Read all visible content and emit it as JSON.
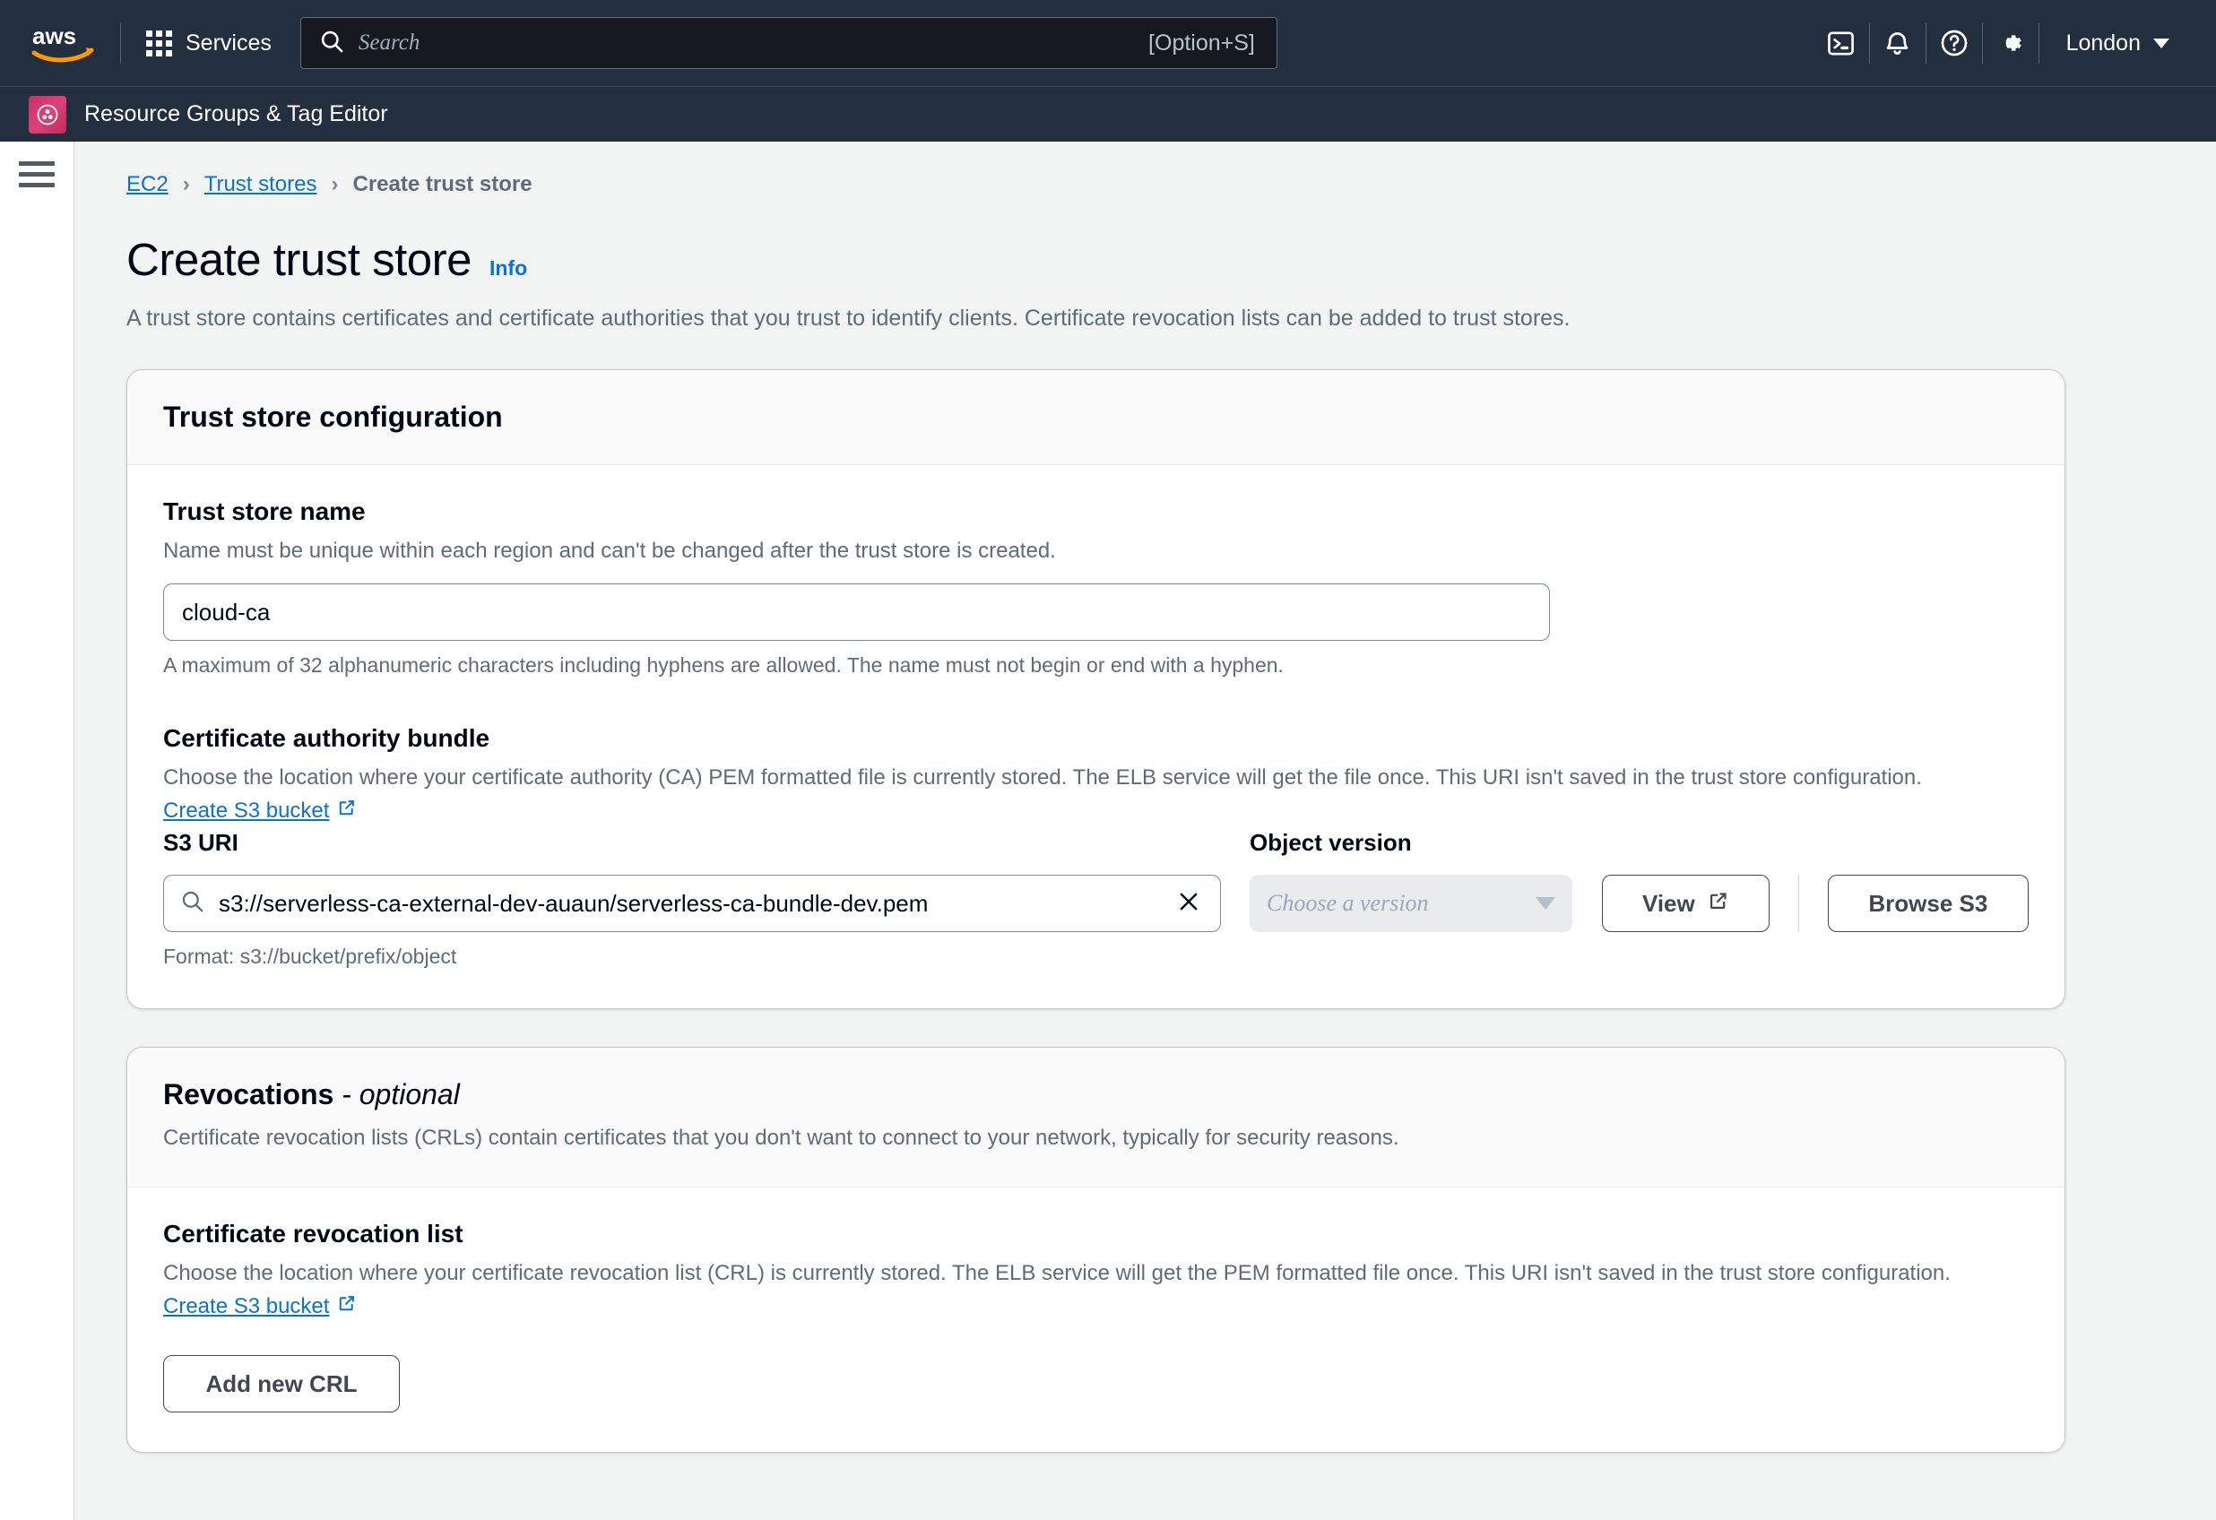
{
  "topnav": {
    "logo_alt": "aws",
    "services_label": "Services",
    "search_placeholder": "Search",
    "search_shortcut": "[Option+S]",
    "icons": [
      "cloudshell-icon",
      "bell-icon",
      "help-icon",
      "settings-icon"
    ],
    "region_label": "London"
  },
  "servicebar": {
    "title": "Resource Groups & Tag Editor"
  },
  "breadcrumb": {
    "items": [
      {
        "label": "EC2",
        "type": "link"
      },
      {
        "label": "Trust stores",
        "type": "link"
      },
      {
        "label": "Create trust store",
        "type": "current"
      }
    ],
    "separator": "›"
  },
  "header": {
    "title": "Create trust store",
    "info_label": "Info",
    "description": "A trust store contains certificates and certificate authorities that you trust to identify clients. Certificate revocation lists can be added to trust stores."
  },
  "config_card": {
    "title": "Trust store configuration",
    "name_field": {
      "label": "Trust store name",
      "hint": "Name must be unique within each region and can't be changed after the trust store is created.",
      "value": "cloud-ca",
      "constraint": "A maximum of 32 alphanumeric characters including hyphens are allowed. The name must not begin or end with a hyphen."
    },
    "ca_bundle": {
      "label": "Certificate authority bundle",
      "description": "Choose the location where your certificate authority (CA) PEM formatted file is currently stored. The ELB service will get the file once. This URI isn't saved in the trust store configuration.",
      "create_bucket_link": "Create S3 bucket",
      "s3_uri_label": "S3 URI",
      "s3_uri_value": "s3://serverless-ca-external-dev-auaun/serverless-ca-bundle-dev.pem",
      "s3_uri_format": "Format: s3://bucket/prefix/object",
      "object_version_label": "Object version",
      "object_version_placeholder": "Choose a version",
      "view_button": "View",
      "browse_button": "Browse S3"
    }
  },
  "revocations_card": {
    "title": "Revocations",
    "title_optional": "- optional",
    "subtitle": "Certificate revocation lists (CRLs) contain certificates that you don't want to connect to your network, typically for security reasons.",
    "crl": {
      "label": "Certificate revocation list",
      "description": "Choose the location where your certificate revocation list (CRL) is currently stored. The ELB service will get the PEM formatted file once. This URI isn't saved in the trust store configuration.",
      "create_bucket_link": "Create S3 bucket",
      "add_button": "Add new CRL"
    }
  },
  "colors": {
    "nav_bg": "#232f3e",
    "link_blue": "#0972d3",
    "page_bg": "#f2f3f3",
    "text_secondary": "#5f6b7a",
    "service_badge": "#c7305f"
  }
}
